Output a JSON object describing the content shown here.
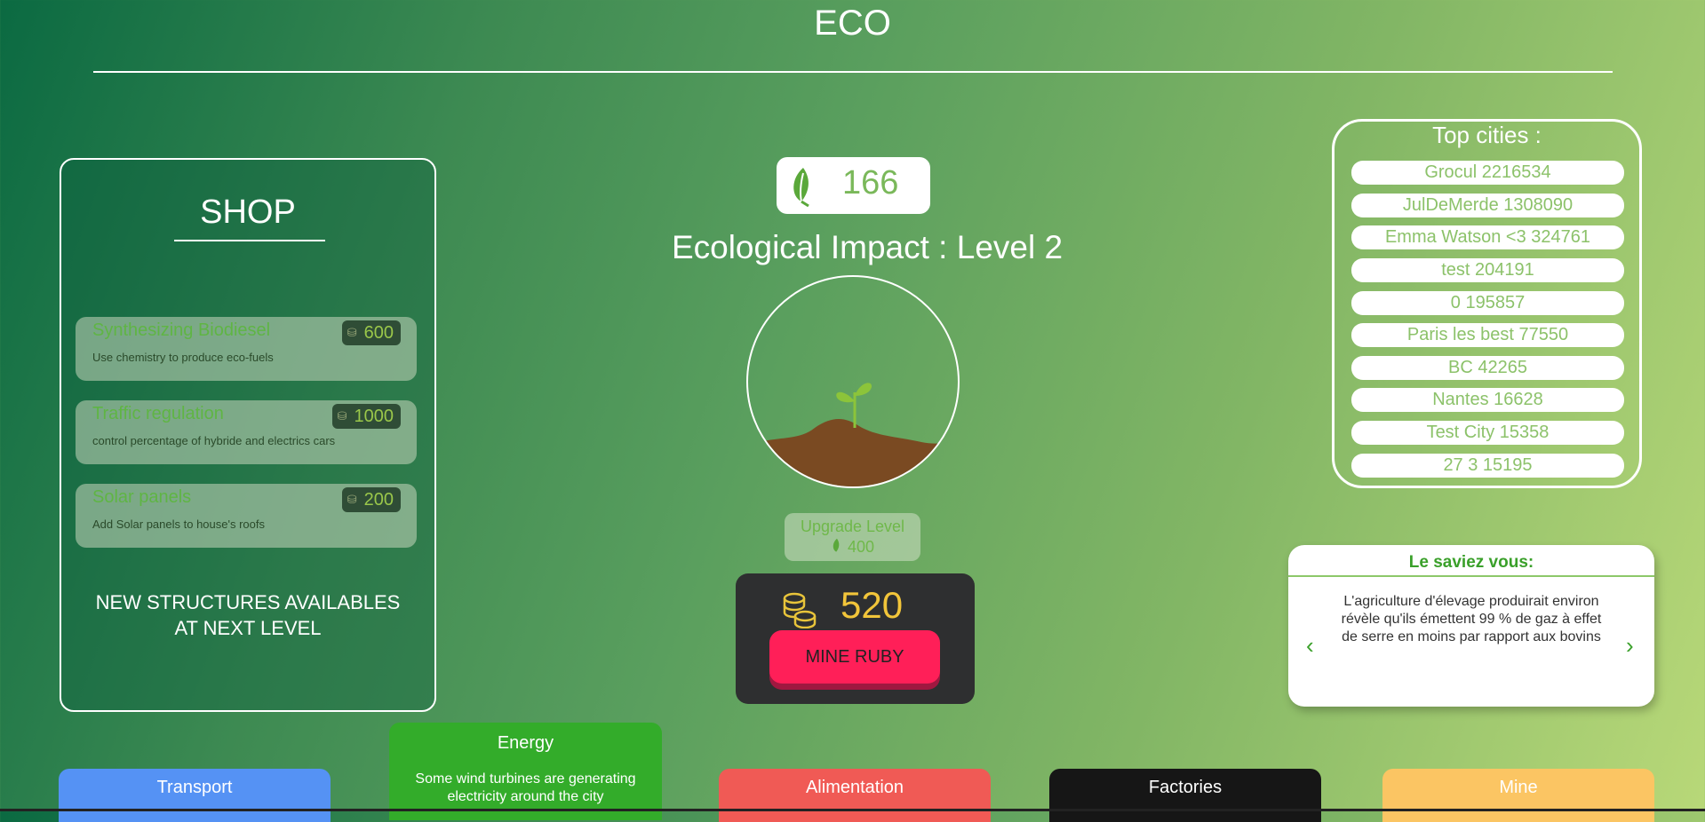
{
  "header": {
    "title": "ECO"
  },
  "shop": {
    "title": "SHOP",
    "items": [
      {
        "name": "Synthesizing Biodiesel",
        "description": "Use chemistry to produce eco-fuels",
        "price": "600"
      },
      {
        "name": "Traffic regulation",
        "description": "control percentage of hybride and electrics cars",
        "price": "1000"
      },
      {
        "name": "Solar panels",
        "description": "Add Solar panels to house's roofs",
        "price": "200"
      }
    ],
    "note": "NEW STRUCTURES AVAILABLES\nAT NEXT LEVEL"
  },
  "eco": {
    "leaves": "166",
    "impact_label": "Ecological Impact : Level 2",
    "upgrade_label": "Upgrade Level",
    "upgrade_cost": "400"
  },
  "mine": {
    "coins": "520",
    "button_label": "MINE RUBY"
  },
  "top_cities": {
    "title": "Top cities :",
    "entries": [
      "Grocul 2216534",
      "JulDeMerde 1308090",
      "Emma Watson <3 324761",
      "test 204191",
      "0 195857",
      "Paris les best 77550",
      "BC 42265",
      "Nantes 16628",
      "Test City 15358",
      "27 3 15195"
    ]
  },
  "info": {
    "title": "Le saviez vous:",
    "text": "L'agriculture d'élevage produirait environ révèle qu'ils émettent 99 % de gaz à effet de serre en moins par rapport aux bovins",
    "prev_icon": "chevron-left-icon",
    "next_icon": "chevron-right-icon",
    "prev": "‹",
    "next": "›"
  },
  "tabs": {
    "transport": "Transport",
    "energy": "Energy",
    "energy_desc": "Some wind turbines are generating electricity around the city",
    "alimentation": "Alimentation",
    "factories": "Factories",
    "mine": "Mine"
  },
  "colors": {
    "transport": "#5592f4",
    "energy": "#33ac2a",
    "alimentation": "#f05a55",
    "factories": "#161616",
    "mine": "#fbc563",
    "accent_green": "#7ab85a",
    "coin_gold": "#f2c53a",
    "mine_button": "#ff1f58"
  }
}
